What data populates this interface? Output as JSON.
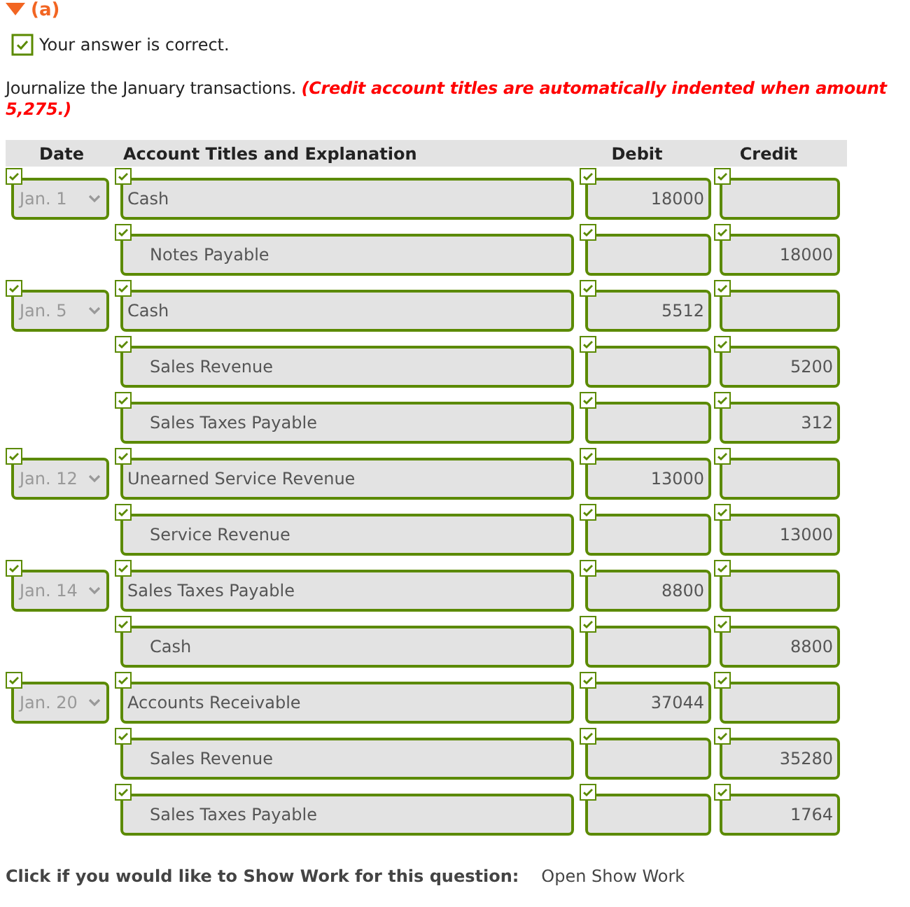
{
  "part_label": "(a)",
  "result": {
    "correct": true,
    "text": "Your answer is correct."
  },
  "instructions": "Journalize the January transactions. *(Credit account titles are automatically indented when amount\n5,275.)*",
  "table": {
    "columns": [
      "Date",
      "Account Titles and Explanation",
      "Debit",
      "Credit"
    ],
    "rows": [
      {
        "date": "Jan. 1",
        "account": "Cash",
        "indented": false,
        "debit": "18000",
        "correct": true
      },
      {
        "account": "Notes Payable",
        "indented": true,
        "credit": "18000",
        "correct": true
      },
      {
        "date": "Jan. 5",
        "account": "Cash",
        "indented": false,
        "debit": "5512",
        "correct": true
      },
      {
        "account": "Sales Revenue",
        "indented": true,
        "credit": "5200",
        "correct": true
      },
      {
        "account": "Sales Taxes Payable",
        "indented": true,
        "credit": "312",
        "correct": true
      },
      {
        "date": "Jan. 12",
        "account": "Unearned Service Revenue",
        "indented": false,
        "debit": "13000",
        "correct": true
      },
      {
        "account": "Service Revenue",
        "indented": true,
        "credit": "13000",
        "correct": true
      },
      {
        "date": "Jan. 14",
        "account": "Sales Taxes Payable",
        "indented": false,
        "debit": "8800",
        "correct": true
      },
      {
        "account": "Cash",
        "indented": true,
        "credit": "8800",
        "correct": true
      },
      {
        "date": "Jan. 20",
        "account": "Accounts Receivable",
        "indented": false,
        "debit": "37044",
        "correct": true
      },
      {
        "account": "Sales Revenue",
        "indented": true,
        "credit": "35280",
        "correct": true
      },
      {
        "account": "Sales Taxes Payable",
        "indented": true,
        "credit": "1764",
        "correct": true
      }
    ]
  },
  "show_work": {
    "prompt": "Click if you would like to Show Work for this question:",
    "link": "Open Show Work"
  }
}
